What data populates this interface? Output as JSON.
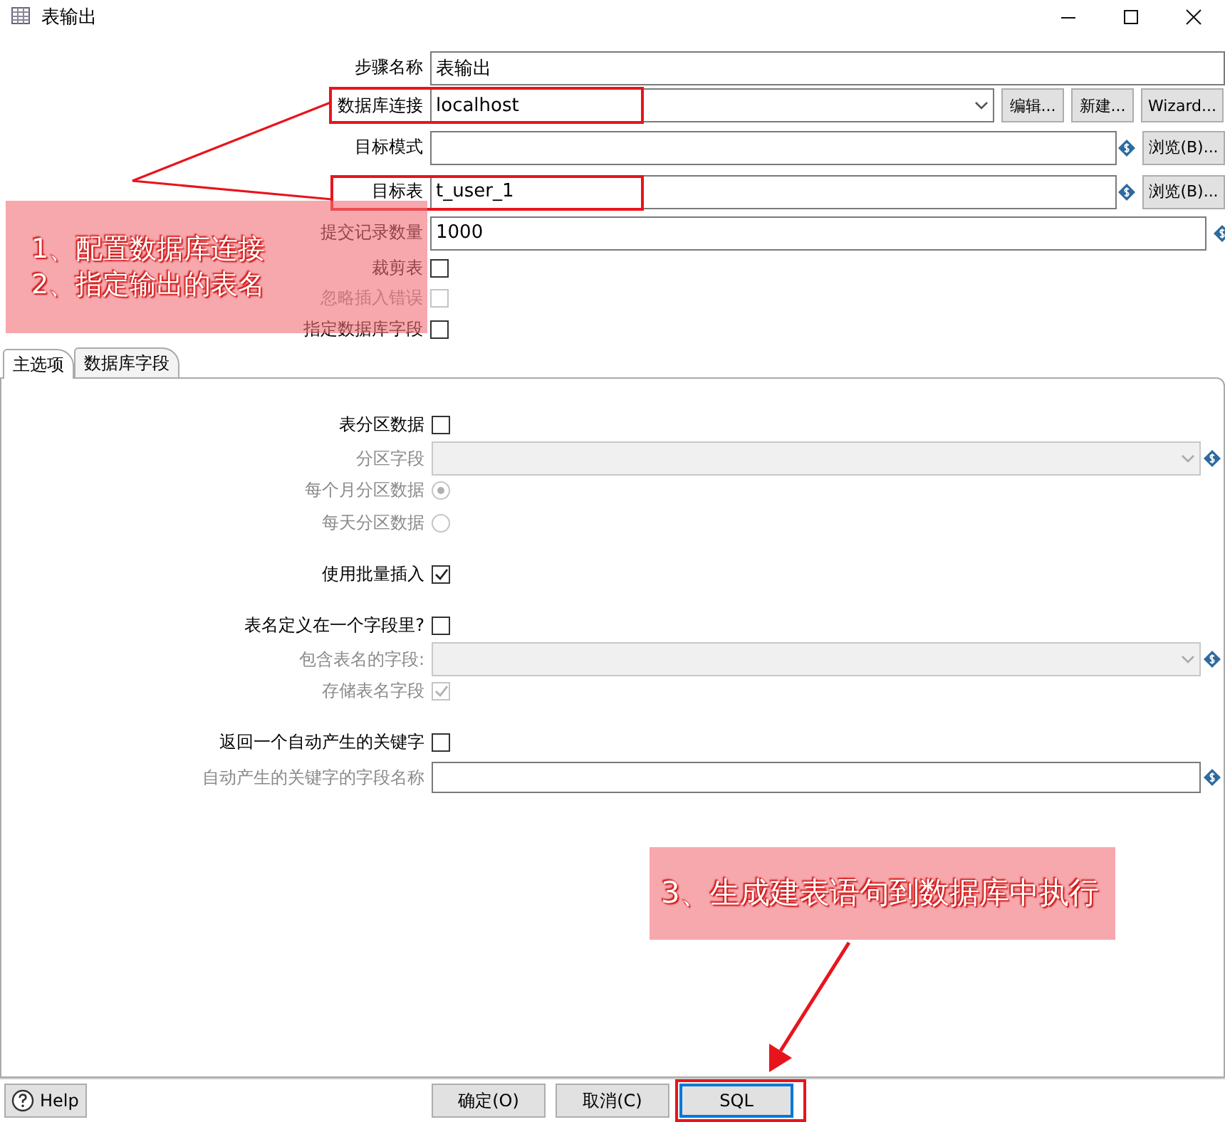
{
  "window": {
    "title": "表输出"
  },
  "fields": [
    {
      "kind": "text",
      "label": "步骤名称",
      "value": "表输出"
    },
    {
      "kind": "combo",
      "label": "数据库连接",
      "value": "localhost",
      "buttons": [
        "编辑...",
        "新建...",
        "Wizard..."
      ]
    },
    {
      "kind": "browse",
      "label": "目标模式",
      "button": "浏览(B)..."
    },
    {
      "kind": "browse",
      "label": "目标表",
      "value": "t_user_1",
      "button": "浏览(B)..."
    },
    {
      "kind": "variable",
      "label": "提交记录数量",
      "value": "1000"
    },
    {
      "kind": "checkbox",
      "label": "裁剪表",
      "checked": false,
      "disabled": false
    },
    {
      "kind": "checkbox",
      "label": "忽略插入错误",
      "checked": false,
      "disabled": true
    },
    {
      "kind": "checkbox",
      "label": "指定数据库字段",
      "checked": false,
      "disabled": false
    }
  ],
  "tabs": [
    {
      "label": "主选项",
      "selected": true
    },
    {
      "label": "数据库字段",
      "selected": false
    }
  ],
  "option_groups": [
    [
      {
        "kind": "checkbox",
        "label": "表分区数据",
        "checked": false,
        "disabled": false
      },
      {
        "kind": "combo",
        "label": "分区字段",
        "disabled": true
      },
      {
        "kind": "radio",
        "label": "每个月分区数据",
        "selected": true,
        "disabled": true
      },
      {
        "kind": "radio",
        "label": "每天分区数据",
        "selected": false,
        "disabled": true
      }
    ],
    [
      {
        "kind": "checkbox",
        "label": "使用批量插入",
        "checked": true,
        "disabled": false
      }
    ],
    [
      {
        "kind": "checkbox",
        "label": "表名定义在一个字段里?",
        "checked": false,
        "disabled": false
      },
      {
        "kind": "combo",
        "label": "包含表名的字段:",
        "disabled": true
      },
      {
        "kind": "checkbox",
        "label": "存储表名字段",
        "checked": true,
        "disabled": true
      }
    ],
    [
      {
        "kind": "checkbox",
        "label": "返回一个自动产生的关键字",
        "checked": false,
        "disabled": false
      },
      {
        "kind": "text",
        "label": "自动产生的关键字的字段名称",
        "disabled": true
      }
    ]
  ],
  "footer": {
    "help": "Help",
    "buttons": [
      {
        "label": "确定(O)",
        "focused": false
      },
      {
        "label": "取消(C)",
        "focused": false
      },
      {
        "label": "SQL",
        "focused": true
      }
    ]
  },
  "callouts": [
    {
      "lines": [
        "1、配置数据库连接",
        "2、指定输出的表名"
      ]
    },
    {
      "lines": [
        "3、生成建表语句到数据库中执行"
      ]
    }
  ]
}
